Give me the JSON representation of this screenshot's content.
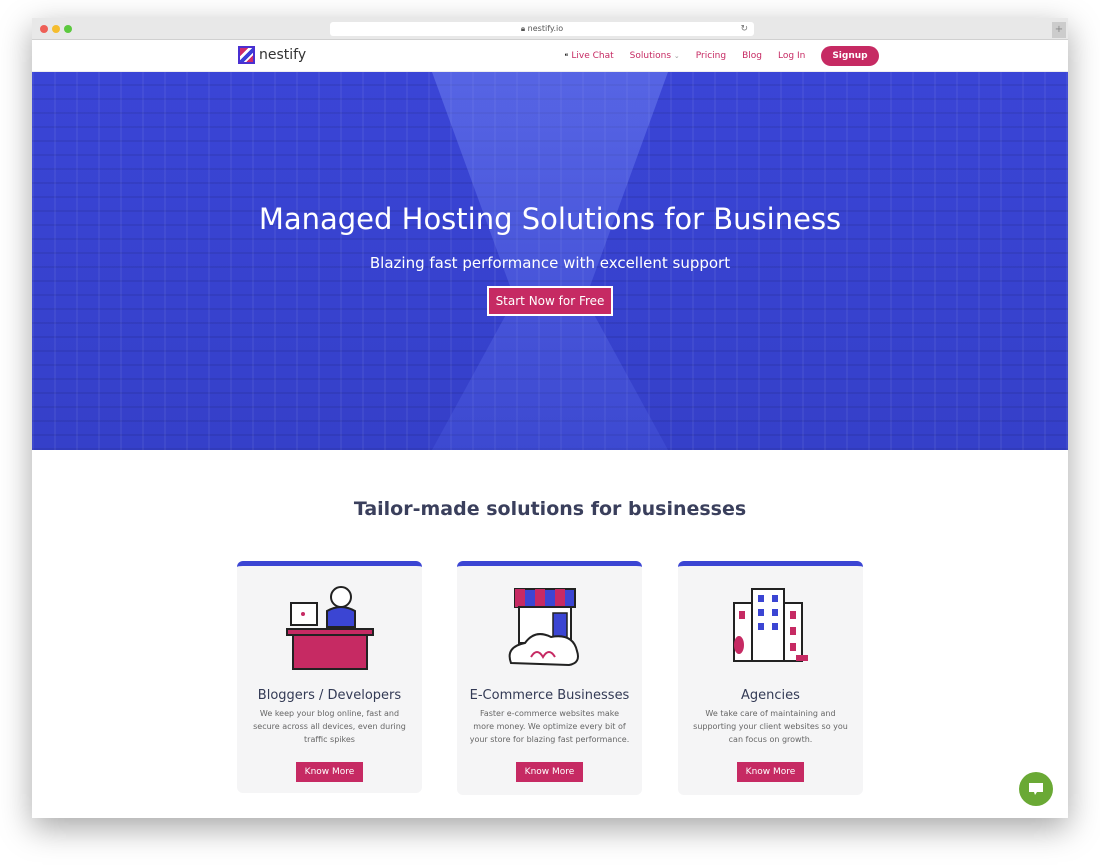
{
  "browser": {
    "url": "nestify.io"
  },
  "nav": {
    "logo": "nestify",
    "items": [
      {
        "label": "Live Chat"
      },
      {
        "label": "Solutions"
      },
      {
        "label": "Pricing"
      },
      {
        "label": "Blog"
      },
      {
        "label": "Log In"
      }
    ],
    "signup": "Signup"
  },
  "hero": {
    "title": "Managed Hosting Solutions for Business",
    "subtitle": "Blazing fast performance with excellent support",
    "cta": "Start Now for Free"
  },
  "section": {
    "title": "Tailor-made solutions for businesses"
  },
  "cards": [
    {
      "title": "Bloggers / Developers",
      "text": "We keep your blog online, fast and secure across all devices, even during traffic spikes",
      "button": "Know More",
      "icon": "developer-desk-icon"
    },
    {
      "title": "E-Commerce Businesses",
      "text": "Faster e-commerce websites make more money. We optimize every bit of your store for blazing fast performance.",
      "button": "Know More",
      "icon": "shop-cart-icon"
    },
    {
      "title": "Agencies",
      "text": "We take care of maintaining and supporting your client websites so you can focus on growth.",
      "button": "Know More",
      "icon": "buildings-icon"
    }
  ],
  "colors": {
    "brand": "#c62a63",
    "hero": "#3a45d6",
    "chat": "#6aa935"
  }
}
